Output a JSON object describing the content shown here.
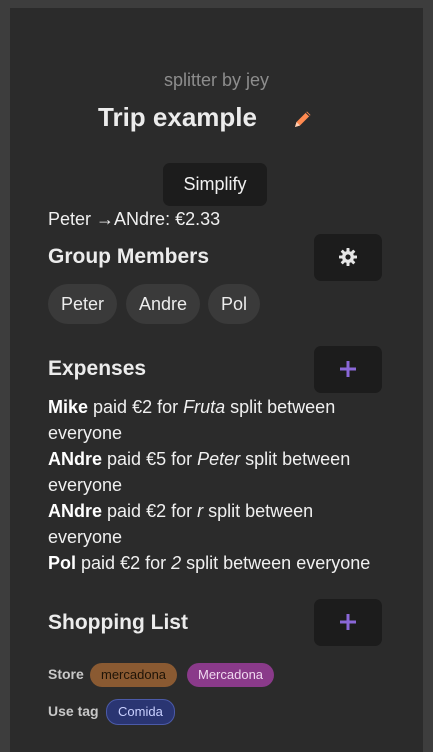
{
  "app": {
    "brand": "splitter by jey",
    "trip_title": "Trip example",
    "simplify_label": "Simplify"
  },
  "settlement": {
    "from": "Peter",
    "arrow": "→",
    "to": "ANdre",
    "amount": "€2.33"
  },
  "members": {
    "heading": "Group Members",
    "items": [
      "Peter",
      "Andre",
      "Pol"
    ]
  },
  "expenses": {
    "heading": "Expenses",
    "items": [
      {
        "payer": "Mike",
        "paid_text": " paid ",
        "amount": "€2",
        "for_text": " for ",
        "item": "Fruta",
        "split_text": " split between everyone"
      },
      {
        "payer": "ANdre",
        "paid_text": " paid ",
        "amount": "€5",
        "for_text": " for ",
        "item": "Peter",
        "split_text": " split between everyone"
      },
      {
        "payer": "ANdre",
        "paid_text": " paid ",
        "amount": "€2",
        "for_text": " for ",
        "item": "r",
        "split_text": " split between everyone"
      },
      {
        "payer": "Pol",
        "paid_text": " paid ",
        "amount": "€2",
        "for_text": " for ",
        "item": "2",
        "split_text": " split between everyone"
      }
    ]
  },
  "shopping": {
    "heading": "Shopping List",
    "store_label": "Store",
    "stores": [
      "mercadona",
      "Mercadona"
    ],
    "use_tag_label": "Use tag",
    "tags": [
      "Comida"
    ]
  },
  "colors": {
    "accent_icon": "#8a67d8",
    "edit_icon": "#ff8a50",
    "background": "#2b2b2b"
  },
  "icons": {
    "edit": "pencil-icon",
    "settings": "gear-icon",
    "add": "plus-icon"
  }
}
